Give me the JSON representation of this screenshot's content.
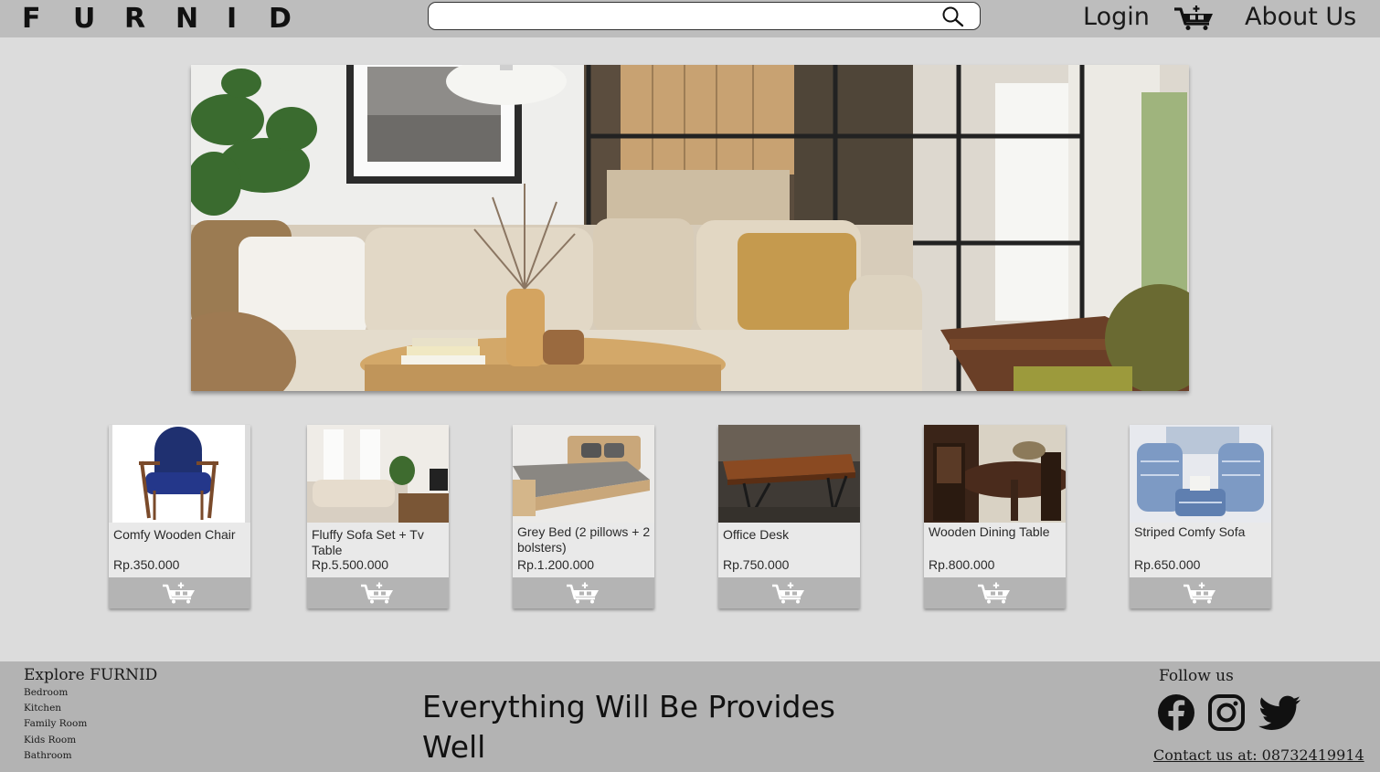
{
  "header": {
    "logo_letters": [
      "F",
      "U",
      "R",
      "N",
      "I",
      "D"
    ],
    "search_placeholder": "",
    "login_label": "Login",
    "about_label": "About Us"
  },
  "hero": {
    "image": "living-room-interior"
  },
  "products": [
    {
      "name": "Comfy Wooden Chair",
      "price": "Rp.350.000",
      "image": "blue-wooden-chair"
    },
    {
      "name": "Fluffy Sofa Set + Tv Table",
      "price": "Rp.5.500.000",
      "image": "sofa-set-living-room"
    },
    {
      "name": "Grey Bed (2 pillows + 2 bolsters)",
      "price": "Rp.1.200.000",
      "image": "wooden-bed"
    },
    {
      "name": "Office Desk",
      "price": "Rp.750.000",
      "image": "wooden-office-desk"
    },
    {
      "name": "Wooden Dining Table",
      "price": "Rp.800.000",
      "image": "dining-table-set"
    },
    {
      "name": "Striped Comfy Sofa",
      "price": "Rp.650.000",
      "image": "striped-blue-armchairs"
    }
  ],
  "footer": {
    "explore_title": "Explore FURNID",
    "explore_links": [
      "Bedroom",
      "Kitchen",
      "Family Room",
      "Kids Room",
      "Bathroom"
    ],
    "tagline": "Everything Will Be Provides Well",
    "follow_label": "Follow us",
    "social_icons": [
      "facebook-icon",
      "instagram-icon",
      "twitter-icon"
    ],
    "contact": "Contact us at: 08732419914"
  },
  "colors": {
    "page_bg": "#dcdcdc",
    "header_bg": "#bdbdbd",
    "footer_bg": "#b3b3b3",
    "card_bg": "#e9e9e9",
    "cart_bar": "#b4b4b4"
  }
}
